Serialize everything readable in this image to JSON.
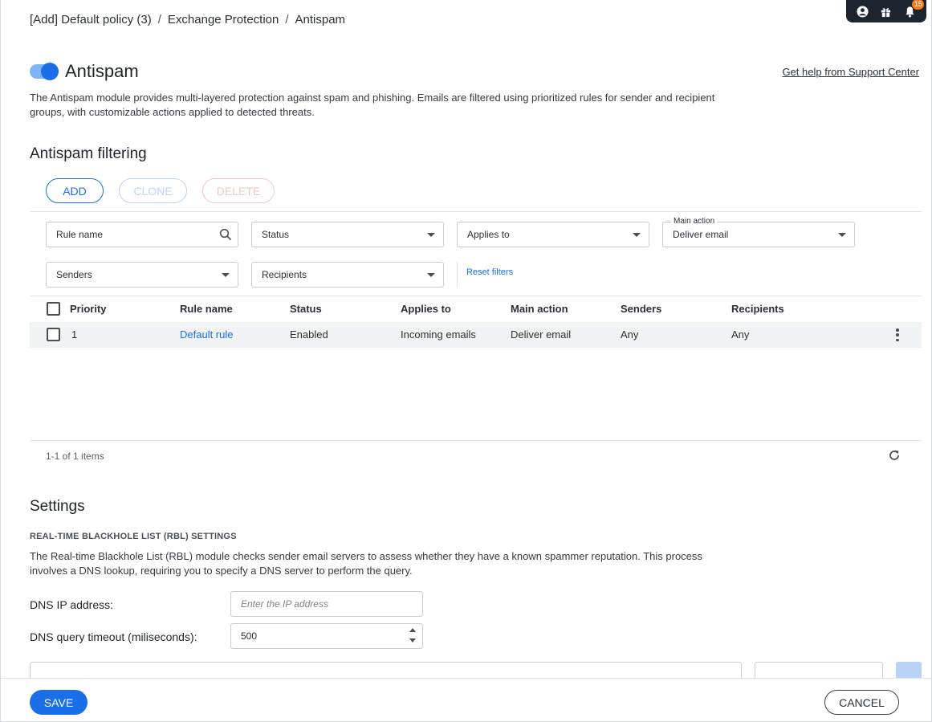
{
  "breadcrumb": {
    "items": [
      "[Add] Default policy (3)",
      "Exchange Protection",
      "Antispam"
    ],
    "separator": "/"
  },
  "header": {
    "notification_count": "15",
    "icons": [
      "account-icon",
      "gift-icon",
      "bell-icon"
    ]
  },
  "module": {
    "title": "Antispam",
    "enabled": true,
    "help_link": "Get help from Support Center",
    "description": "The Antispam module provides multi-layered protection against spam and phishing. Emails are filtered using prioritized rules for sender and recipient groups, with customizable actions applied to detected threats."
  },
  "filtering": {
    "title": "Antispam filtering",
    "buttons": {
      "add": "ADD",
      "clone": "CLONE",
      "delete": "DELETE"
    },
    "filters": {
      "rule_name_placeholder": "Rule name",
      "status": "Status",
      "applies_to": "Applies to",
      "main_action_label": "Main action",
      "main_action_value": "Deliver email",
      "senders": "Senders",
      "recipients": "Recipients",
      "reset": "Reset filters"
    },
    "columns": [
      "Priority",
      "Rule name",
      "Status",
      "Applies to",
      "Main action",
      "Senders",
      "Recipients"
    ],
    "rows": [
      {
        "priority": "1",
        "rule_name": "Default rule",
        "status": "Enabled",
        "applies_to": "Incoming emails",
        "main_action": "Deliver email",
        "senders": "Any",
        "recipients": "Any"
      }
    ],
    "pager": "1-1 of 1 items"
  },
  "settings": {
    "title": "Settings",
    "rbl_heading": "REAL-TIME BLACKHOLE LIST (RBL) SETTINGS",
    "rbl_description": "The Real-time Blackhole List (RBL) module checks sender email servers to assess whether they have a known spammer reputation. This process involves a DNS lookup, requiring you to specify a DNS server to perform the query.",
    "dns_ip_label": "DNS IP address:",
    "dns_ip_placeholder": "Enter the IP address",
    "dns_timeout_label": "DNS query timeout (miliseconds):",
    "dns_timeout_value": "500"
  },
  "footer": {
    "save": "SAVE",
    "cancel": "CANCEL"
  },
  "colors": {
    "accent": "#1a6ee8",
    "header_bg": "#1c2430",
    "badge": "#f47a20"
  }
}
